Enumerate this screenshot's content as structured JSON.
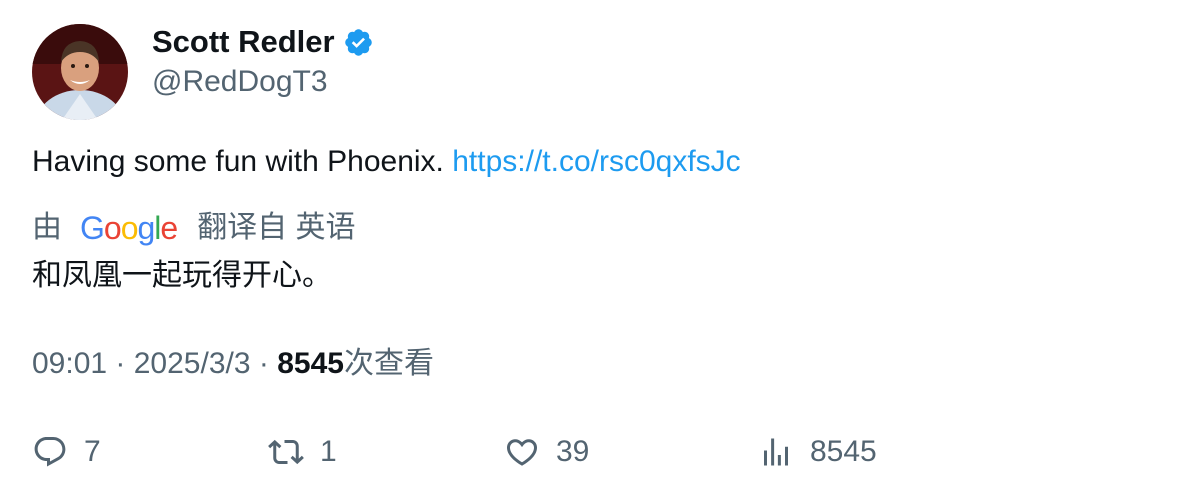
{
  "author": {
    "display_name": "Scott Redler",
    "handle": "@RedDogT3",
    "verified_icon": "verified-badge-icon"
  },
  "tweet": {
    "text": "Having some fun with Phoenix. ",
    "link": "https://t.co/rsc0qxfsJc"
  },
  "translation": {
    "prefix": "由",
    "provider": "Google",
    "suffix": "翻译自 英语",
    "text": "和凤凰一起玩得开心。"
  },
  "meta": {
    "time": "09:01",
    "separator": " · ",
    "date": "2025/3/3",
    "views_count": "8545",
    "views_label": "次查看"
  },
  "actions": {
    "replies": "7",
    "retweets": "1",
    "likes": "39",
    "views": "8545"
  },
  "colors": {
    "link": "#1d9bf0",
    "secondary_text": "#536471",
    "primary_text": "#0f1419",
    "verified": "#1d9bf0"
  }
}
